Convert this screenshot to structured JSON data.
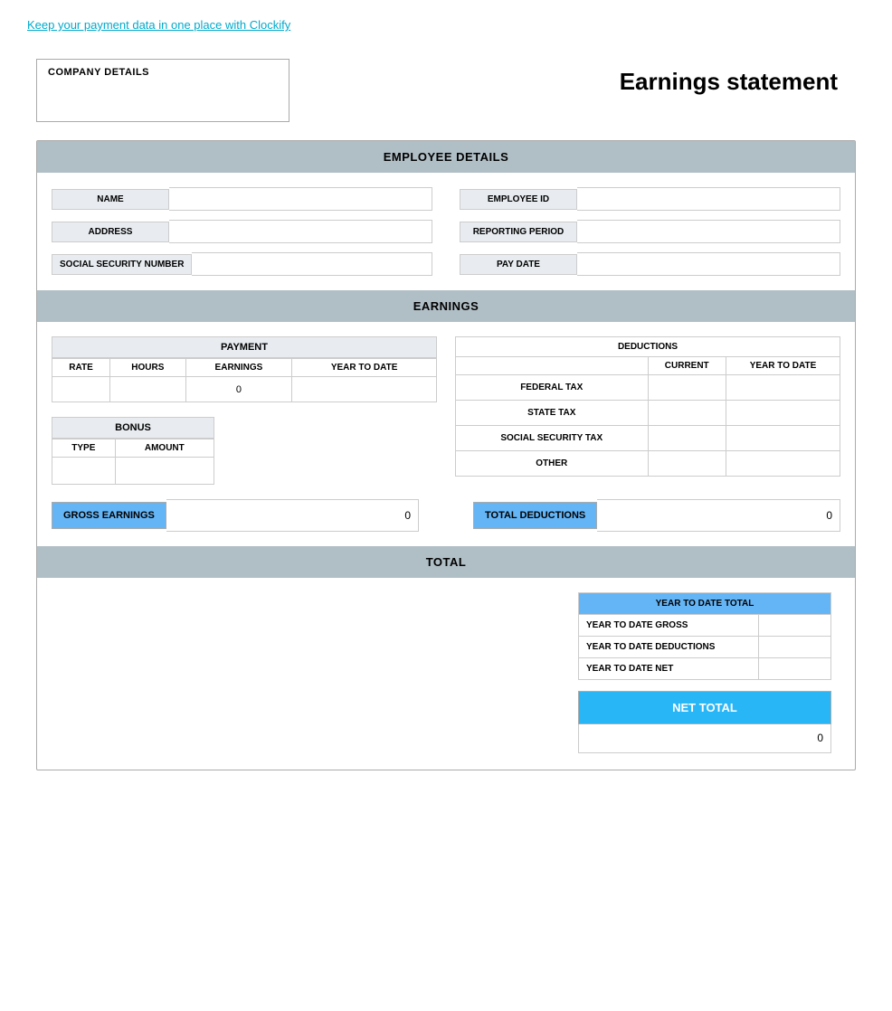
{
  "topLink": {
    "text": "Keep your payment data in one place with Clockify"
  },
  "header": {
    "companyLabel": "COMPANY DETAILS",
    "pageTitle": "Earnings statement"
  },
  "employeeDetails": {
    "sectionTitle": "EMPLOYEE DETAILS",
    "fields": {
      "name": {
        "label": "NAME",
        "value": ""
      },
      "address": {
        "label": "ADDRESS",
        "value": ""
      },
      "ssn": {
        "label": "SOCIAL SECURITY NUMBER",
        "value": ""
      },
      "employeeId": {
        "label": "EMPLOYEE ID",
        "value": ""
      },
      "reportingPeriod": {
        "label": "REPORTING PERIOD",
        "value": ""
      },
      "payDate": {
        "label": "PAY DATE",
        "value": ""
      }
    }
  },
  "earnings": {
    "sectionTitle": "EARNINGS",
    "payment": {
      "tableLabel": "PAYMENT",
      "columns": [
        "RATE",
        "HOURS",
        "EARNINGS",
        "YEAR TO DATE"
      ],
      "rows": [
        {
          "rate": "",
          "hours": "",
          "earnings": "0",
          "ytd": ""
        }
      ]
    },
    "deductions": {
      "tableLabel": "DEDUCTIONS",
      "columns": [
        "CURRENT",
        "YEAR TO DATE"
      ],
      "rows": [
        {
          "label": "FEDERAL TAX",
          "current": "",
          "ytd": ""
        },
        {
          "label": "STATE TAX",
          "current": "",
          "ytd": ""
        },
        {
          "label": "SOCIAL SECURITY TAX",
          "current": "",
          "ytd": ""
        },
        {
          "label": "OTHER",
          "current": "",
          "ytd": ""
        }
      ]
    },
    "bonus": {
      "tableLabel": "BONUS",
      "columns": [
        "TYPE",
        "AMOUNT"
      ],
      "rows": [
        {
          "type": "",
          "amount": ""
        }
      ]
    },
    "grossEarnings": {
      "label": "GROSS EARNINGS",
      "value": "0"
    },
    "totalDeductions": {
      "label": "TOTAL DEDUCTIONS",
      "value": "0"
    }
  },
  "total": {
    "sectionTitle": "TOTAL",
    "ytdTotal": {
      "title": "YEAR TO DATE TOTAL",
      "rows": [
        {
          "label": "YEAR TO DATE GROSS",
          "value": ""
        },
        {
          "label": "YEAR TO DATE DEDUCTIONS",
          "value": ""
        },
        {
          "label": "YEAR TO DATE NET",
          "value": ""
        }
      ]
    },
    "netTotal": {
      "label": "NET TOTAL",
      "value": "0"
    }
  }
}
